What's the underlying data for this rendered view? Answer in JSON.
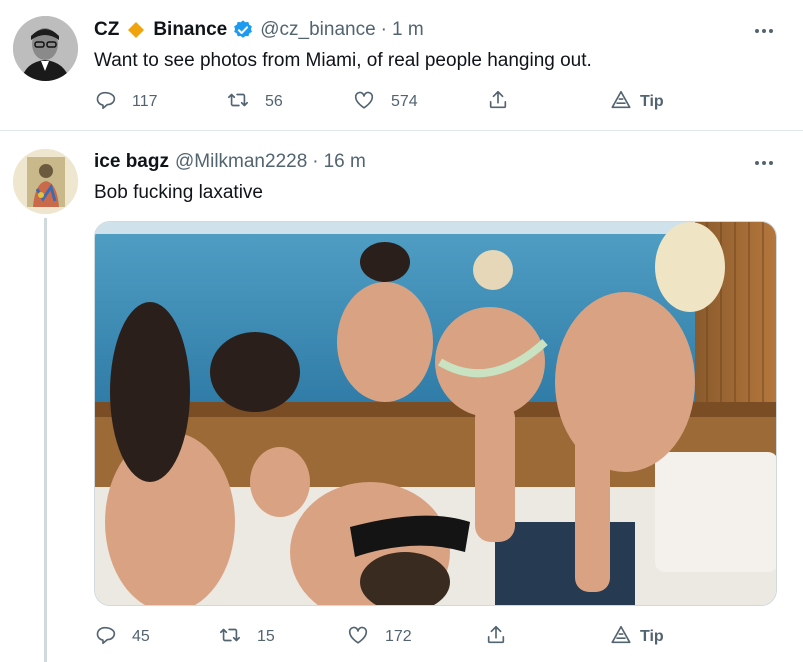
{
  "tweets": [
    {
      "display_name": "CZ",
      "suffix_name": "Binance",
      "handle": "@cz_binance",
      "separator": "·",
      "time": "1 m",
      "text": "Want to see photos from Miami, of real people hanging out.",
      "replies": "117",
      "retweets": "56",
      "likes": "574",
      "tip_label": "Tip",
      "verified": true,
      "badge_icon": "orange-diamond-icon"
    },
    {
      "display_name": "ice bagz",
      "handle": "@Milkman2228",
      "separator": "·",
      "time": "16 m",
      "text": "Bob fucking laxative",
      "replies": "45",
      "retweets": "15",
      "likes": "172",
      "tip_label": "Tip",
      "has_media": true
    }
  ],
  "colors": {
    "text_primary": "#0f1419",
    "text_secondary": "#536471",
    "verified_blue": "#1d9bf0",
    "binance_orange": "#f0a30a",
    "divider": "#e1e8ed"
  },
  "icons": [
    "reply-icon",
    "retweet-icon",
    "like-icon",
    "share-icon",
    "tip-icon",
    "more-icon"
  ]
}
